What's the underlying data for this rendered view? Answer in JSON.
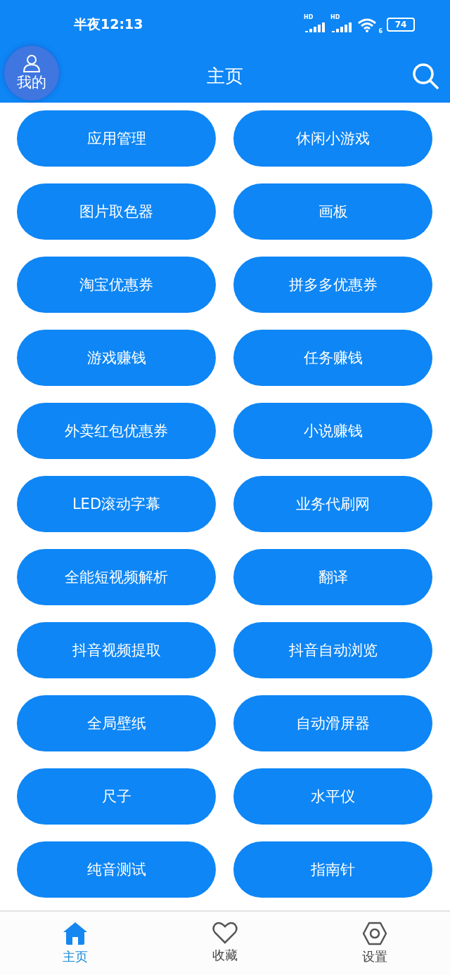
{
  "status_bar": {
    "time": "半夜12:13",
    "signal_labels": [
      "HD",
      "HD"
    ],
    "wifi_label": "6",
    "battery": "74"
  },
  "toolbar": {
    "profile_label": "我的",
    "title": "主页"
  },
  "tools": [
    {
      "label": "应用管理"
    },
    {
      "label": "休闲小游戏"
    },
    {
      "label": "图片取色器"
    },
    {
      "label": "画板"
    },
    {
      "label": "淘宝优惠券"
    },
    {
      "label": "拼多多优惠券"
    },
    {
      "label": "游戏赚钱"
    },
    {
      "label": "任务赚钱"
    },
    {
      "label": "外卖红包优惠券"
    },
    {
      "label": "小说赚钱"
    },
    {
      "label": "LED滚动字幕"
    },
    {
      "label": "业务代刷网"
    },
    {
      "label": "全能短视频解析"
    },
    {
      "label": "翻译"
    },
    {
      "label": "抖音视频提取"
    },
    {
      "label": "抖音自动浏览"
    },
    {
      "label": "全局壁纸"
    },
    {
      "label": "自动滑屏器"
    },
    {
      "label": "尺子"
    },
    {
      "label": "水平仪"
    },
    {
      "label": "纯音测试"
    },
    {
      "label": "指南针"
    }
  ],
  "bottom_nav": [
    {
      "kind": "home",
      "label": "主页",
      "selected": true
    },
    {
      "kind": "favorites",
      "label": "收藏",
      "selected": false
    },
    {
      "kind": "settings",
      "label": "设置",
      "selected": false
    }
  ]
}
